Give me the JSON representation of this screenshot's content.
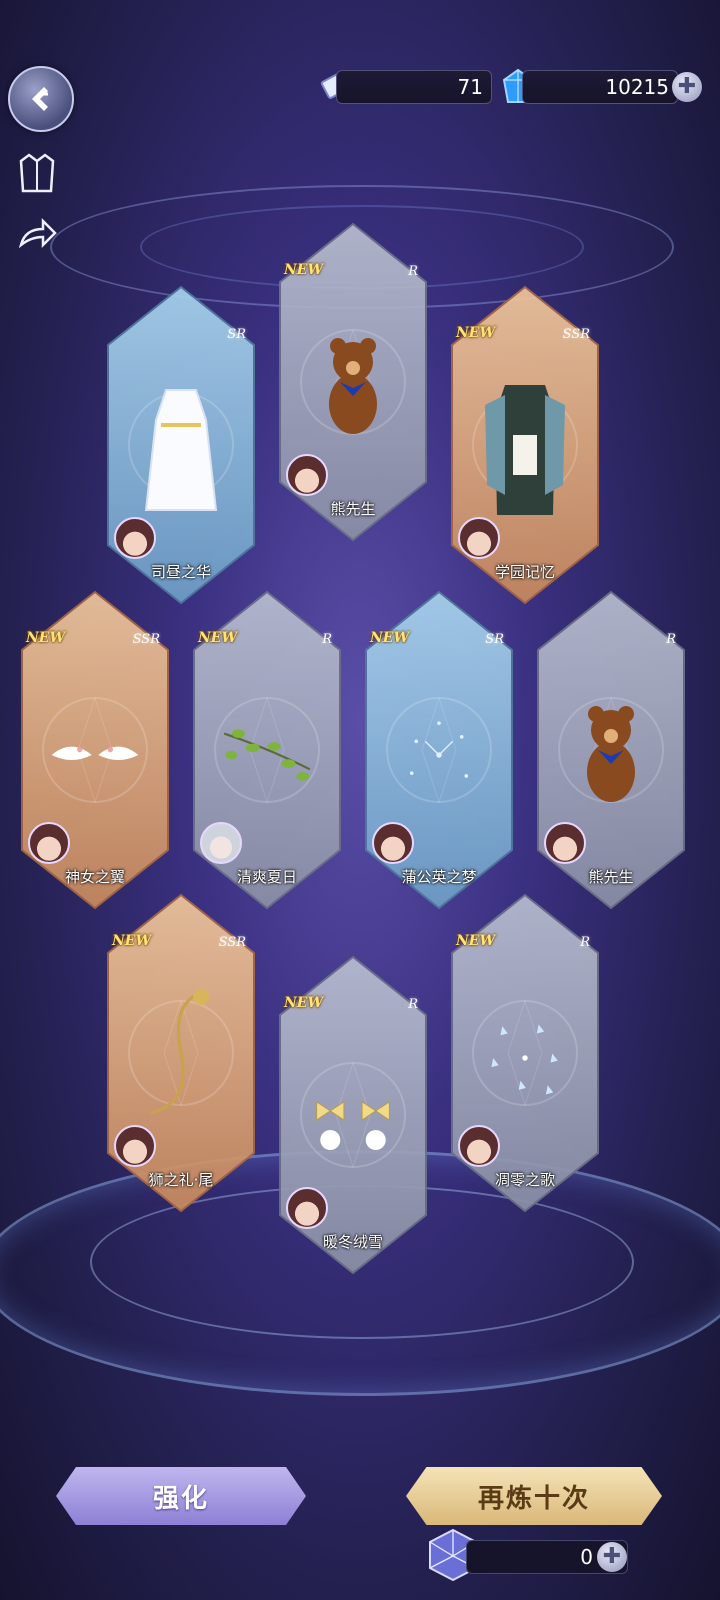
{
  "currency": {
    "tickets": "71",
    "diamonds": "10215"
  },
  "cards": [
    {
      "name": "司昼之华",
      "rarity": "SR",
      "is_new": false,
      "avatar": "girl"
    },
    {
      "name": "熊先生",
      "rarity": "R",
      "is_new": true,
      "avatar": "girl"
    },
    {
      "name": "学园记忆",
      "rarity": "SSR",
      "is_new": true,
      "avatar": "girl"
    },
    {
      "name": "神女之翼",
      "rarity": "SSR",
      "is_new": true,
      "avatar": "girl"
    },
    {
      "name": "清爽夏日",
      "rarity": "R",
      "is_new": true,
      "avatar": "silver"
    },
    {
      "name": "蒲公英之梦",
      "rarity": "SR",
      "is_new": true,
      "avatar": "girl"
    },
    {
      "name": "熊先生",
      "rarity": "R",
      "is_new": false,
      "avatar": "girl"
    },
    {
      "name": "狮之礼·尾",
      "rarity": "SSR",
      "is_new": true,
      "avatar": "boy"
    },
    {
      "name": "暖冬绒雪",
      "rarity": "R",
      "is_new": true,
      "avatar": "girl"
    },
    {
      "name": "凋零之歌",
      "rarity": "R",
      "is_new": true,
      "avatar": "girl"
    }
  ],
  "labels": {
    "new": "NEW"
  },
  "buttons": {
    "enhance": "强化",
    "draw_ten_again": "再炼十次"
  },
  "crystal_count": "0",
  "colors": {
    "ssr_frame": "#d99a6c",
    "sr_frame": "#7fb0d6",
    "r_frame": "#8e93a8"
  }
}
